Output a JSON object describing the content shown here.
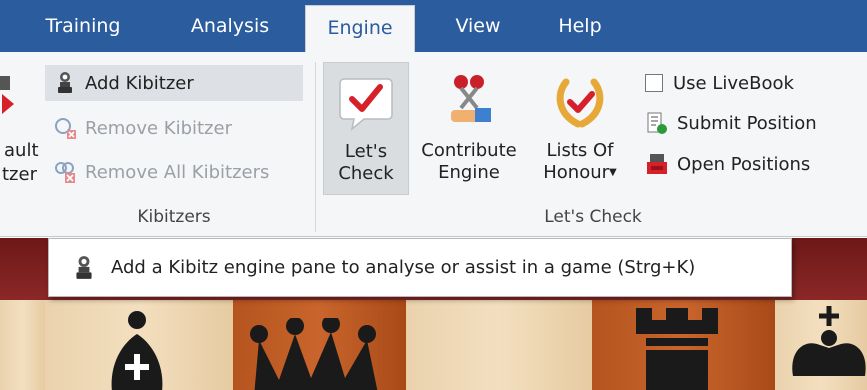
{
  "menu": {
    "tabs": [
      "Training",
      "Analysis",
      "Engine",
      "View",
      "Help"
    ],
    "active_tab": "Engine"
  },
  "ribbon": {
    "left_partial": {
      "line1": "ault",
      "line2": "tzer"
    },
    "kibitzers": {
      "add_label": "Add Kibitzer",
      "remove_label": "Remove Kibitzer",
      "remove_all_label": "Remove All Kibitzers",
      "group_label": "Kibitzers"
    },
    "lets_check": {
      "lets_check_line1": "Let's",
      "lets_check_line2": "Check",
      "contribute_line1": "Contribute",
      "contribute_line2": "Engine",
      "honour_line1": "Lists Of",
      "honour_line2": "Honour",
      "use_livebook_label": "Use LiveBook",
      "submit_position_label": "Submit Position",
      "open_positions_label": "Open Positions",
      "group_label": "Let's Check"
    }
  },
  "tooltip": {
    "text": "Add a Kibitz engine pane to analyse or assist in a game (Strg+K)"
  },
  "colors": {
    "menubar": "#2b5c9e",
    "ribbon": "#f5f6f7",
    "board_frame": "#7a1f1f",
    "light_square": "#ecd5b0",
    "dark_square": "#b9561f",
    "check_red": "#d6202a"
  },
  "icons": {
    "kibitzer": "kibitzer-engine-icon",
    "contribute": "contribute-engine-icon",
    "honour": "laurel-wreath-icon",
    "submit": "submit-position-icon",
    "open": "open-positions-icon"
  }
}
